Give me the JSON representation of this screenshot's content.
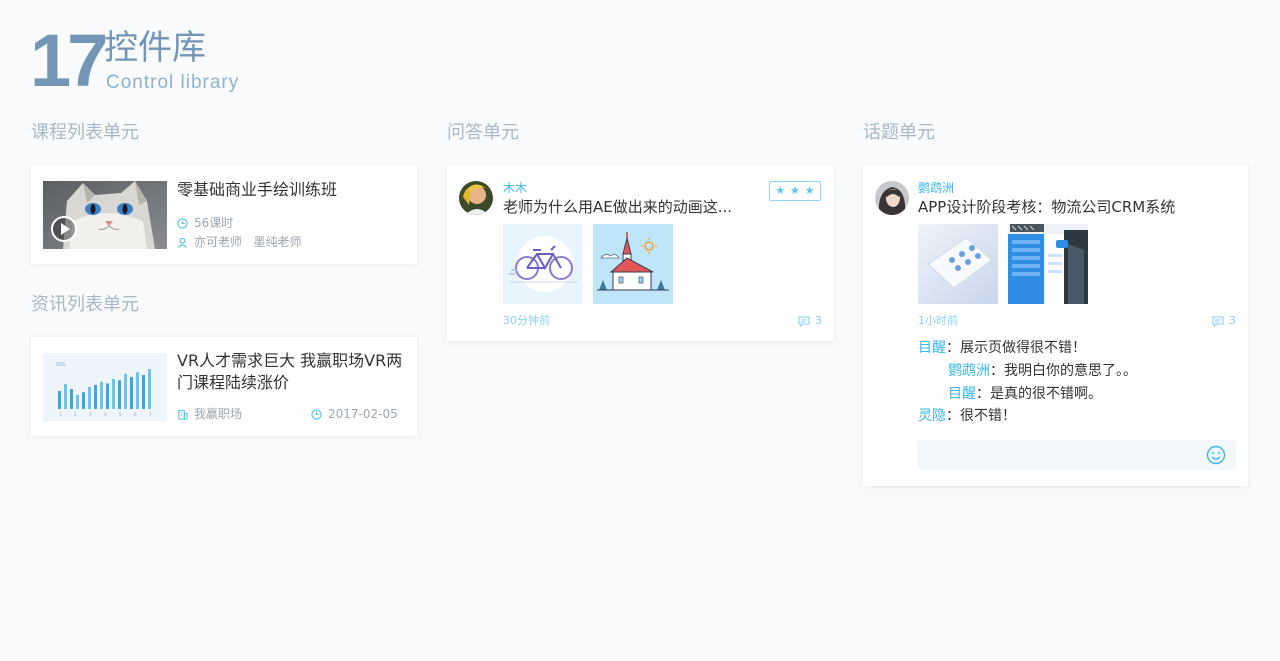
{
  "header": {
    "number": "17",
    "title": "控件库",
    "subtitle": "Control library"
  },
  "sections": {
    "course": "课程列表单元",
    "news": "资讯列表单元",
    "qa": "问答单元",
    "topic": "话题单元"
  },
  "course_card": {
    "title": "零基础商业手绘训练班",
    "hours": "56课时",
    "teachers": "亦可老师   墨纯老师"
  },
  "news_card": {
    "title_line1": "VR人才需求巨大 我赢职场VR两",
    "title_line2": "门课程陆续涨价",
    "source": "我赢职场",
    "date": "2017-02-05",
    "chart_label": "VOL",
    "chart_ticks": [
      "1",
      "2",
      "3",
      "4",
      "5",
      "6",
      "7"
    ],
    "chart_bars": [
      0.45,
      0.62,
      0.5,
      0.35,
      0.42,
      0.55,
      0.6,
      0.68,
      0.64,
      0.75,
      0.72,
      0.88,
      0.8,
      0.92,
      0.85,
      1.0
    ]
  },
  "qa_card": {
    "user": "木木",
    "question": "老师为什么用AE做出来的动画这...",
    "time": "30分钟前",
    "comments": "3",
    "stars": [
      "★",
      "★",
      "★"
    ]
  },
  "topic_card": {
    "user": "鹦鹉洲",
    "title": "APP设计阶段考核：物流公司CRM系统",
    "time": "1小时前",
    "comments_count": "3",
    "comments": [
      {
        "who": "目醒",
        "text": "：展示页做得很不错！"
      },
      {
        "who": "鹦鹉洲",
        "text": "：我明白你的意思了。。"
      },
      {
        "who": "目醒",
        "text": "：是真的很不错啊。"
      },
      {
        "who": "灵隐",
        "text": "：很不错！"
      }
    ]
  },
  "colors": {
    "accent": "#3ab7ea",
    "heading": "#7496b6",
    "section": "#a8b8c6"
  }
}
